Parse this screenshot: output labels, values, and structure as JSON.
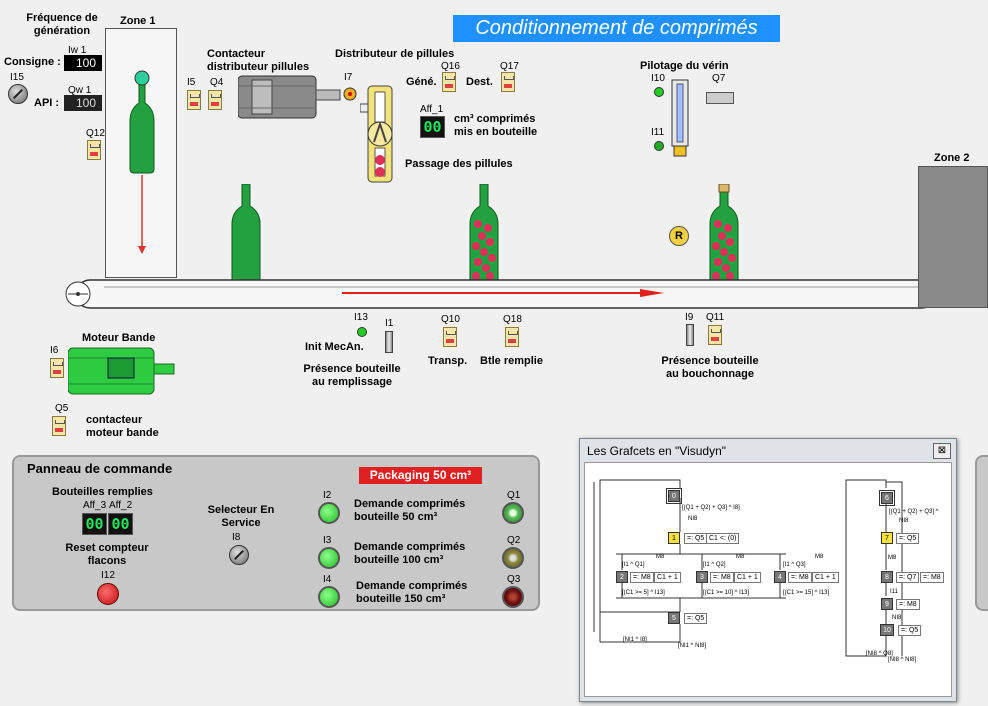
{
  "title": "Conditionnement de comprimés",
  "zones": {
    "zone1": "Zone 1",
    "zone2": "Zone 2"
  },
  "frequence": {
    "label": "Fréquence de génération",
    "consigne_label": "Consigne :",
    "consigne_tag": "Iw 1",
    "consigne_value": "100",
    "api_label": "API :",
    "api_tag": "Qw 1",
    "api_value": "100",
    "knob_tag": "I15"
  },
  "zone1_tags": {
    "i5": "I5",
    "q4": "Q4",
    "q12": "Q12"
  },
  "contacteur": {
    "label": "Contacteur distributeur pillules",
    "i7": "I7"
  },
  "distributeur": {
    "label": "Distributeur de pillules",
    "gene": "Géné.",
    "dest": "Dest.",
    "q16": "Q16",
    "q17": "Q17",
    "aff_tag": "Aff_1",
    "aff_value": "00",
    "cm3_label": "cm³ comprimés mis en bouteille",
    "passage_label": "Passage des pillules"
  },
  "verin": {
    "label": "Pilotage du vérin",
    "i10": "I10",
    "q7": "Q7",
    "i11": "I11"
  },
  "conveyor": {
    "i13": "I13",
    "init_label": "Init MecAn.",
    "i1": "I1",
    "presence_remplissage": "Présence bouteille au remplissage",
    "q10": "Q10",
    "transp": "Transp.",
    "q18": "Q18",
    "btle_remplie": "Btle remplie",
    "i9": "I9",
    "q11": "Q11",
    "presence_bouchonnage": "Présence bouteille au bouchonnage",
    "r_badge": "R"
  },
  "moteur": {
    "label": "Moteur Bande",
    "i6": "I6",
    "q5": "Q5",
    "contacteur_label": "contacteur moteur bande"
  },
  "panel": {
    "title": "Panneau de commande",
    "bouteilles_label": "Bouteilles remplies",
    "aff3_tag": "Aff_3",
    "aff2_tag": "Aff_2",
    "aff3_value": "00",
    "aff2_value": "00",
    "reset_label": "Reset compteur flacons",
    "i12": "I12",
    "selecteur_label": "Selecteur En Service",
    "i8": "I8",
    "packaging_badge": "Packaging 50 cm³",
    "demandes": [
      {
        "tag": "I2",
        "label": "Demande comprimés bouteille 50 cm³",
        "out": "Q1"
      },
      {
        "tag": "I3",
        "label": "Demande comprimés bouteille 100 cm³",
        "out": "Q2"
      },
      {
        "tag": "I4",
        "label": "Demande comprimés bouteille 150 cm³",
        "out": "Q3"
      }
    ]
  },
  "grafcet": {
    "window_title": "Les Grafcets en \"Visudyn\"",
    "close": "⊠",
    "left": {
      "s0": "0",
      "t0": "[(Q1 + Q2) + Q3] ^ I8]",
      "t0b": "NI8",
      "s1": "1",
      "a1": "=: Q5",
      "a1b": "C1 <: (0)",
      "ms": "M8",
      "tA": "[I1 ^ Q1]",
      "tB": "[I1 ^ Q2]",
      "tC": "[I1 ^ Q3]",
      "s2": "2",
      "s3": "3",
      "s4": "4",
      "m8": "=: M8",
      "c1": "C1 + 1",
      "tD": "[(C1 >= 5] ^ I13]",
      "tE": "[(C1 >= 10] ^ I13]",
      "tF": "[(C1 >= 15] ^ I13]",
      "s5": "5",
      "a5": "=: Q5",
      "tG": "[NI1 ^ I8]",
      "tH": "[NI1 ^ NI8]"
    },
    "right": {
      "s6": "6",
      "t6": "[(Q1 + Q2) + Q3] ^",
      "t6b": "NI8",
      "s7": "7",
      "a7": "=: Q5",
      "t7": "M8",
      "s8": "8",
      "a8a": "=: Q7",
      "a8b": "=: M8",
      "t8": "I11",
      "s9": "9",
      "a9": "=: M8",
      "t9": "NI8",
      "s10": "10",
      "a10": "=: Q5",
      "tA": "[NI8 ^ Q8]",
      "tB": "[NI8 ^ NI8]"
    }
  },
  "colors": {
    "title_bg": "#1e90ff",
    "led_green": "#22cc22",
    "packaging_red": "#e02020"
  }
}
